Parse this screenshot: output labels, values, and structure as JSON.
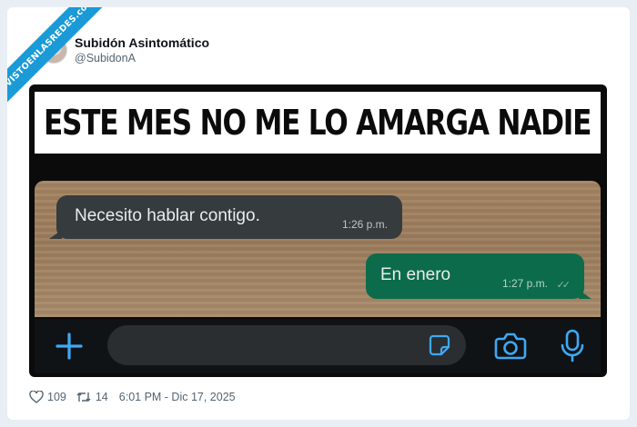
{
  "watermark": {
    "text": "VISTOENLASREDES.com"
  },
  "author": {
    "display_name": "Subidón Asintomático",
    "handle": "@SubidonA"
  },
  "media": {
    "banner_text": "ESTE MES NO ME LO AMARGA NADIE",
    "chat": {
      "messages": [
        {
          "text": "Necesito hablar contigo.",
          "time": "1:26 p.m.",
          "direction": "incoming"
        },
        {
          "text": "En enero",
          "time": "1:27 p.m.",
          "direction": "outgoing",
          "ticks": "✓✓"
        }
      ],
      "input_icons": [
        "plus-icon",
        "sticker-icon",
        "camera-icon",
        "microphone-icon"
      ],
      "accent_color": "#3fa9f5"
    }
  },
  "footer": {
    "likes": "109",
    "reposts": "14",
    "timestamp": "6:01 PM - Dic 17, 2025"
  }
}
